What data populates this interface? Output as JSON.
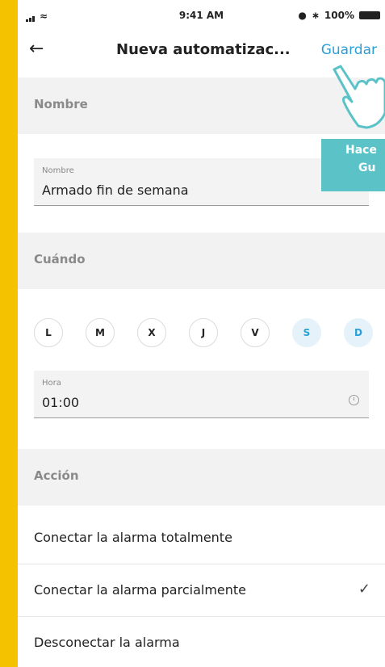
{
  "status_bar": {
    "time": "9:41 AM",
    "battery": "100%"
  },
  "header": {
    "title": "Nueva automatizac...",
    "save_label": "Guardar"
  },
  "name_section": {
    "header": "Nombre",
    "field_label": "Nombre",
    "field_value": "Armado fin de semana"
  },
  "when_section": {
    "header": "Cuándo",
    "days": [
      {
        "label": "L",
        "selected": false
      },
      {
        "label": "M",
        "selected": false
      },
      {
        "label": "X",
        "selected": false
      },
      {
        "label": "J",
        "selected": false
      },
      {
        "label": "V",
        "selected": false
      },
      {
        "label": "S",
        "selected": true
      },
      {
        "label": "D",
        "selected": true
      }
    ],
    "time_label": "Hora",
    "time_value": "01:00"
  },
  "action_section": {
    "header": "Acción",
    "options": [
      {
        "label": "Conectar la alarma totalmente",
        "checked": false
      },
      {
        "label": "Conectar la alarma parcialmente",
        "checked": true
      },
      {
        "label": "Desconectar la alarma",
        "checked": false
      }
    ]
  },
  "hint": {
    "line1": "Hace",
    "line2": "Gu"
  },
  "colors": {
    "accent": "#2a9fd6",
    "background_frame": "#f5c200",
    "hint_box": "#5bc3c8"
  }
}
